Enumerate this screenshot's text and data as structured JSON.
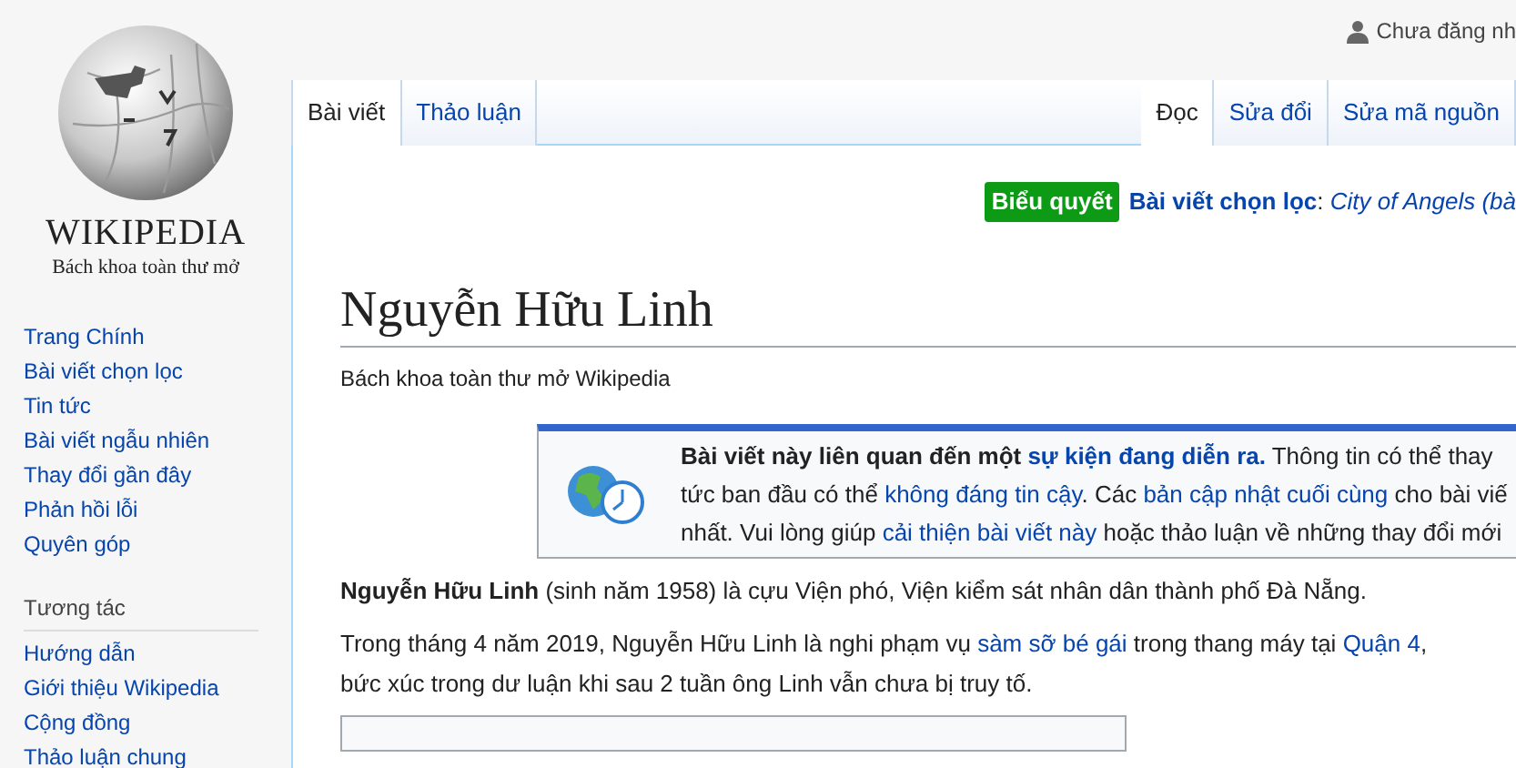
{
  "logo": {
    "wordmark": "WIKIPEDIA",
    "tagline": "Bách khoa toàn thư mở"
  },
  "user_link": "Chưa đăng nh",
  "sidebar": {
    "items": [
      {
        "label": "Trang Chính"
      },
      {
        "label": "Bài viết chọn lọc"
      },
      {
        "label": "Tin tức"
      },
      {
        "label": "Bài viết ngẫu nhiên"
      },
      {
        "label": "Thay đổi gần đây"
      },
      {
        "label": "Phản hồi lỗi"
      },
      {
        "label": "Quyên góp"
      }
    ],
    "sections": [
      {
        "heading": "Tương tác",
        "items": [
          {
            "label": "Hướng dẫn"
          },
          {
            "label": "Giới thiệu Wikipedia"
          },
          {
            "label": "Cộng đồng"
          },
          {
            "label": "Thảo luận chung"
          }
        ]
      }
    ]
  },
  "left_tabs": [
    {
      "label": "Bài viết",
      "selected": true
    },
    {
      "label": "Thảo luận",
      "selected": false
    }
  ],
  "right_tabs": [
    {
      "label": "Đọc",
      "selected": true
    },
    {
      "label": "Sửa đổi",
      "selected": false
    },
    {
      "label": "Sửa mã nguồn",
      "selected": false
    }
  ],
  "featured": {
    "badge": "Biểu quyết",
    "label": "Bài viết chọn lọc",
    "separator": ":",
    "title": "City of Angels (bà"
  },
  "heading": "Nguyễn Hữu Linh",
  "subtitle": "Bách khoa toàn thư mở Wikipedia",
  "notice": {
    "lines": [
      [
        {
          "text": "Bài viết này liên quan đến một ",
          "bold": true,
          "link": false
        },
        {
          "text": "sự kiện đang diễn ra.",
          "bold": true,
          "link": true
        },
        {
          "text": " Thông tin có thể thay",
          "bold": false,
          "link": false
        }
      ],
      [
        {
          "text": "tức ban đầu có thể ",
          "bold": false,
          "link": false
        },
        {
          "text": "không đáng tin cậy",
          "bold": false,
          "link": true
        },
        {
          "text": ". Các ",
          "bold": false,
          "link": false
        },
        {
          "text": "bản cập nhật cuối cùng",
          "bold": false,
          "link": true
        },
        {
          "text": " cho bài viế",
          "bold": false,
          "link": false
        }
      ],
      [
        {
          "text": "nhất. Vui lòng giúp ",
          "bold": false,
          "link": false
        },
        {
          "text": "cải thiện bài viết này",
          "bold": false,
          "link": true
        },
        {
          "text": " hoặc thảo luận về những thay đổi mới",
          "bold": false,
          "link": false
        }
      ]
    ]
  },
  "paragraphs": [
    {
      "lines": [
        [
          {
            "text": "Nguyễn Hữu Linh",
            "bold": true,
            "link": false
          },
          {
            "text": " (sinh năm 1958) là cựu Viện phó, Viện kiểm sát nhân dân thành phố Đà Nẵng.",
            "bold": false,
            "link": false
          }
        ]
      ]
    },
    {
      "lines": [
        [
          {
            "text": "Trong tháng 4 năm 2019, Nguyễn Hữu Linh là nghi phạm vụ ",
            "bold": false,
            "link": false
          },
          {
            "text": "sàm sỡ bé gái",
            "bold": false,
            "link": true
          },
          {
            "text": " trong thang máy tại ",
            "bold": false,
            "link": false
          },
          {
            "text": "Quận 4",
            "bold": false,
            "link": true
          },
          {
            "text": ",",
            "bold": false,
            "link": false
          }
        ],
        [
          {
            "text": "bức xúc trong dư luận khi sau 2 tuần ông Linh vẫn chưa bị truy tố.",
            "bold": false,
            "link": false
          }
        ]
      ]
    }
  ]
}
